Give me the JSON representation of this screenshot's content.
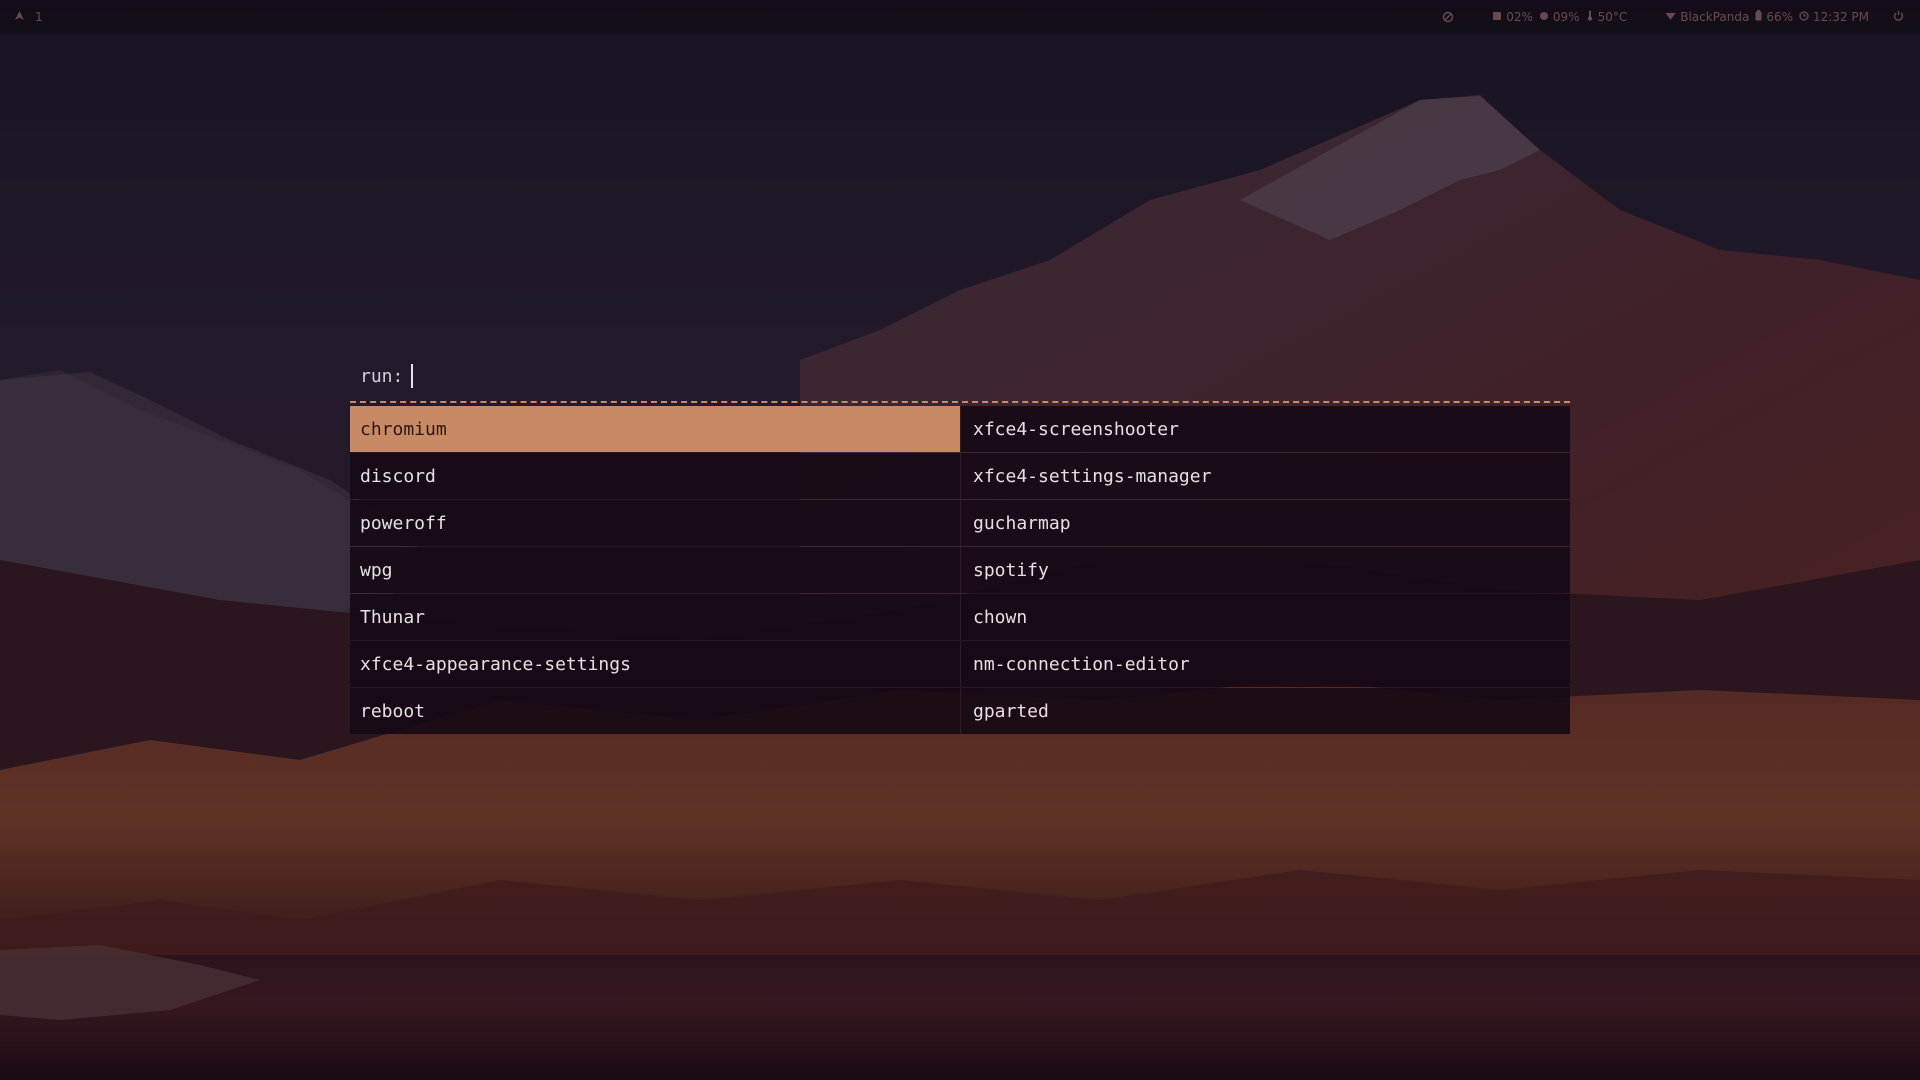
{
  "statusbar": {
    "left": {
      "logo_icon": "arch-icon",
      "workspace": "1"
    },
    "right": {
      "no_signal_icon": "no-signal-icon",
      "cpu_icon": "cpu-icon",
      "cpu": "02%",
      "mem_icon": "memory-icon",
      "mem": "09%",
      "temp_icon": "thermometer-icon",
      "temp": "50°C",
      "wifi_icon": "wifi-icon",
      "network": "BlackPanda",
      "battery_icon": "battery-icon",
      "battery": "66%",
      "clock_icon": "clock-icon",
      "time": "12:32 PM",
      "power_icon": "power-icon"
    }
  },
  "launcher": {
    "prompt": "run:",
    "input_value": "",
    "accent_color": "#c88a64",
    "items": [
      "chromium",
      "xfce4-screenshooter",
      "discord",
      "xfce4-settings-manager",
      "poweroff",
      "gucharmap",
      "wpg",
      "spotify",
      "Thunar",
      "chown",
      "xfce4-appearance-settings",
      "nm-connection-editor",
      "reboot",
      "gparted"
    ],
    "selected": "chromium"
  }
}
